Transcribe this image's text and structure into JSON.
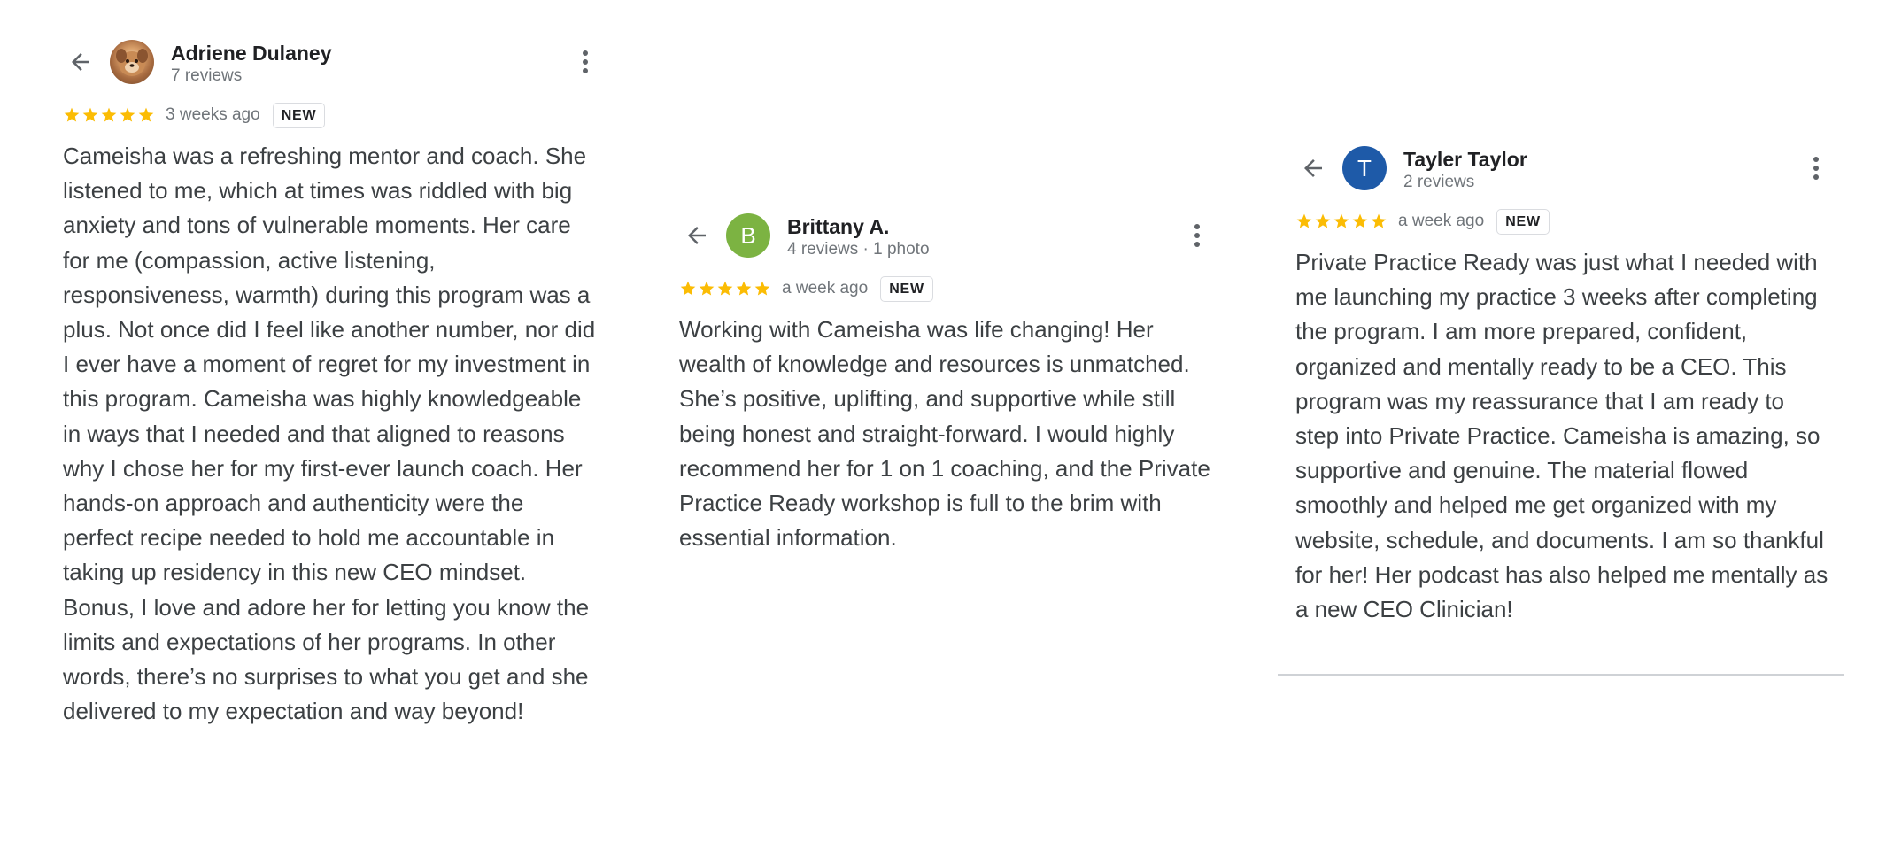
{
  "reviews": [
    {
      "name": "Adriene Dulaney",
      "meta": "7 reviews",
      "avatar_type": "photo",
      "avatar_letter": "",
      "avatar_color": "#a76a3f",
      "rating": 5,
      "date": "3 weeks ago",
      "badge": "NEW",
      "text": "Cameisha was a refreshing mentor and coach. She listened to me, which at times was riddled with big anxiety and tons of vulnerable moments. Her care for me (compassion, active listening, responsiveness, warmth) during this program was a plus. Not once did I feel like another number, nor did I ever have a moment of regret for my investment in this program. Cameisha was highly knowledgeable in ways that I needed and that aligned to reasons why I chose her for my first-ever launch coach. Her hands-on approach and authenticity were the perfect recipe needed to hold me accountable in taking up residency in this new CEO mindset. Bonus, I love and adore her for letting you know the limits and expectations of her programs. In other words, there’s no surprises to what you get and she delivered to my expectation and way beyond!"
    },
    {
      "name": "Brittany A.",
      "meta": "4 reviews · 1 photo",
      "avatar_type": "letter",
      "avatar_letter": "B",
      "avatar_color": "#7cb342",
      "rating": 5,
      "date": "a week ago",
      "badge": "NEW",
      "text": "Working with Cameisha was life changing! Her wealth of knowledge and resources is unmatched. She’s positive, uplifting, and supportive while still being honest and straight-forward. I would highly recommend her for 1 on 1 coaching, and the Private Practice Ready workshop is full to the brim with essential information."
    },
    {
      "name": "Tayler Taylor",
      "meta": "2 reviews",
      "avatar_type": "letter",
      "avatar_letter": "T",
      "avatar_color": "#1e5aa8",
      "rating": 5,
      "date": "a week ago",
      "badge": "NEW",
      "text": "Private Practice Ready was just what I needed with me launching my practice 3 weeks after completing the program. I am more prepared, confident, organized and mentally ready to be a CEO. This program was my reassurance that I am ready to step into Private Practice. Cameisha is amazing, so supportive and genuine. The material flowed smoothly and helped me get organized with my website, schedule, and documents. I am so thankful for her! Her podcast has also helped me mentally as a new CEO Clinician!"
    }
  ],
  "icons": {
    "back": "arrow-back-icon",
    "more": "more-vert-icon",
    "star": "star-icon"
  },
  "colors": {
    "star": "#fbbc04",
    "name": "#202124",
    "meta": "#70757a",
    "body": "#3c4043",
    "badge_border": "#dadce0"
  }
}
